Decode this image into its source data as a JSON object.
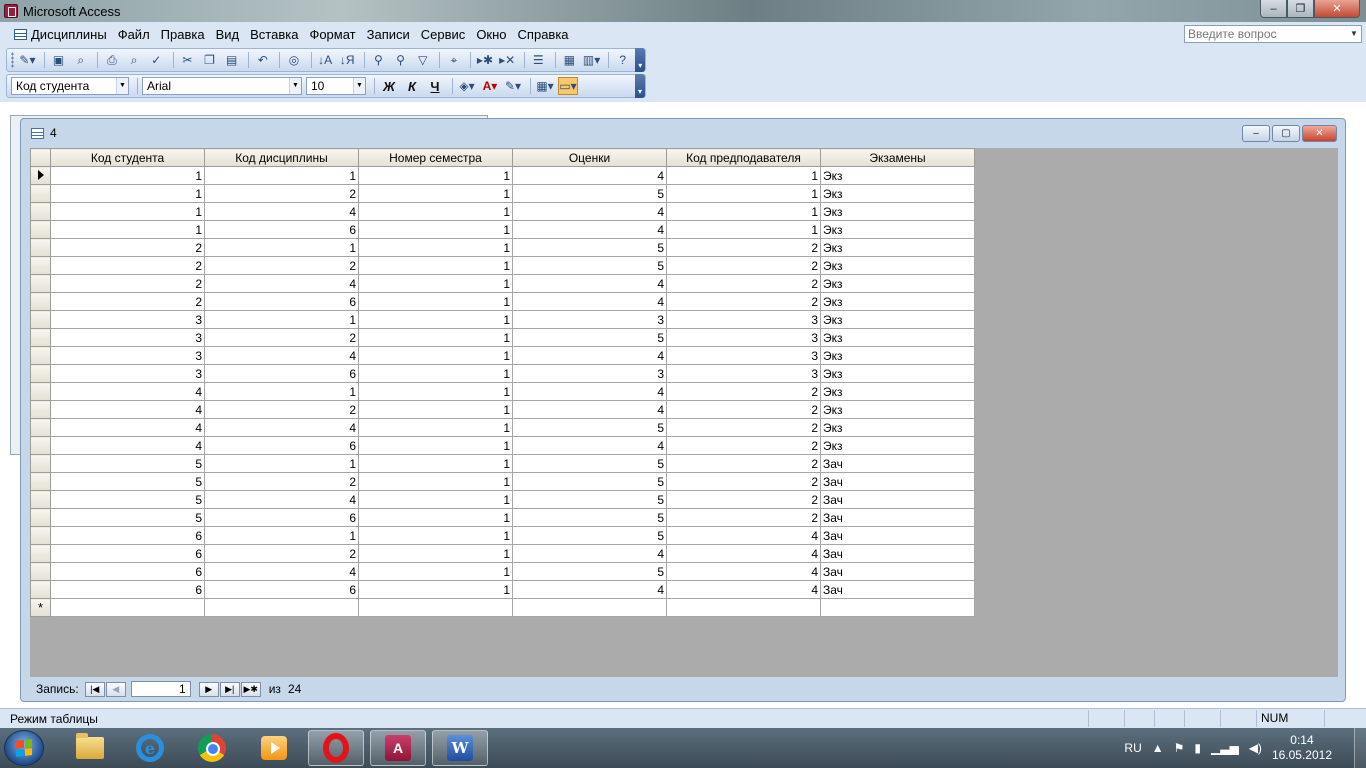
{
  "window": {
    "title": "Microsoft Access",
    "min": "–",
    "max": "❐",
    "close": "✕"
  },
  "menu": {
    "items": [
      "Дисциплины",
      "Файл",
      "Правка",
      "Вид",
      "Вставка",
      "Формат",
      "Записи",
      "Сервис",
      "Окно",
      "Справка"
    ],
    "help_placeholder": "Введите вопрос"
  },
  "toolbar1": {
    "icons": [
      "view-icon",
      "save-icon",
      "search-file-icon",
      "print-icon",
      "print-preview-icon",
      "spelling-icon",
      "cut-icon",
      "copy-icon",
      "paste-icon",
      "undo-icon",
      "hyperlink-icon",
      "sort-asc-icon",
      "sort-desc-icon",
      "filter-by-selection-icon",
      "filter-by-form-icon",
      "apply-filter-icon",
      "find-icon",
      "new-record-icon",
      "delete-record-icon",
      "properties-icon",
      "database-window-icon",
      "new-object-icon",
      "help-icon"
    ]
  },
  "toolbar2": {
    "field_select": "Код студента",
    "font_select": "Arial",
    "size_select": "10",
    "bold_label": "Ж",
    "italic_label": "К",
    "underline_label": "Ч"
  },
  "docwindow": {
    "title": "4"
  },
  "table": {
    "columns": [
      "Код студента",
      "Код дисциплины",
      "Номер семестра",
      "Оценки",
      "Код предподавателя",
      "Экзамены"
    ],
    "rows": [
      [
        "1",
        "1",
        "1",
        "4",
        "1",
        "Экз"
      ],
      [
        "1",
        "2",
        "1",
        "5",
        "1",
        "Экз"
      ],
      [
        "1",
        "4",
        "1",
        "4",
        "1",
        "Экз"
      ],
      [
        "1",
        "6",
        "1",
        "4",
        "1",
        "Экз"
      ],
      [
        "2",
        "1",
        "1",
        "5",
        "2",
        "Экз"
      ],
      [
        "2",
        "2",
        "1",
        "5",
        "2",
        "Экз"
      ],
      [
        "2",
        "4",
        "1",
        "4",
        "2",
        "Экз"
      ],
      [
        "2",
        "6",
        "1",
        "4",
        "2",
        "Экз"
      ],
      [
        "3",
        "1",
        "1",
        "3",
        "3",
        "Экз"
      ],
      [
        "3",
        "2",
        "1",
        "5",
        "3",
        "Экз"
      ],
      [
        "3",
        "4",
        "1",
        "4",
        "3",
        "Экз"
      ],
      [
        "3",
        "6",
        "1",
        "3",
        "3",
        "Экз"
      ],
      [
        "4",
        "1",
        "1",
        "4",
        "2",
        "Экз"
      ],
      [
        "4",
        "2",
        "1",
        "4",
        "2",
        "Экз"
      ],
      [
        "4",
        "4",
        "1",
        "5",
        "2",
        "Экз"
      ],
      [
        "4",
        "6",
        "1",
        "4",
        "2",
        "Экз"
      ],
      [
        "5",
        "1",
        "1",
        "5",
        "2",
        "Зач"
      ],
      [
        "5",
        "2",
        "1",
        "5",
        "2",
        "Зач"
      ],
      [
        "5",
        "4",
        "1",
        "5",
        "2",
        "Зач"
      ],
      [
        "5",
        "6",
        "1",
        "5",
        "2",
        "Зач"
      ],
      [
        "6",
        "1",
        "1",
        "5",
        "4",
        "Зач"
      ],
      [
        "6",
        "2",
        "1",
        "4",
        "4",
        "Зач"
      ],
      [
        "6",
        "4",
        "1",
        "5",
        "4",
        "Зач"
      ],
      [
        "6",
        "6",
        "1",
        "4",
        "4",
        "Зач"
      ]
    ],
    "new_row_marker": "*"
  },
  "navigator": {
    "label": "Запись:",
    "current": "1",
    "of_label": "из",
    "total": "24"
  },
  "statusbar": {
    "text": "Режим таблицы",
    "num": "NUM"
  },
  "taskbar": {
    "apps": [
      "explorer-icon",
      "internet-explorer-icon",
      "chrome-icon",
      "media-player-icon",
      "opera-icon",
      "access-icon",
      "word-icon"
    ],
    "lang": "RU",
    "time": "0:14",
    "date": "16.05.2012"
  }
}
